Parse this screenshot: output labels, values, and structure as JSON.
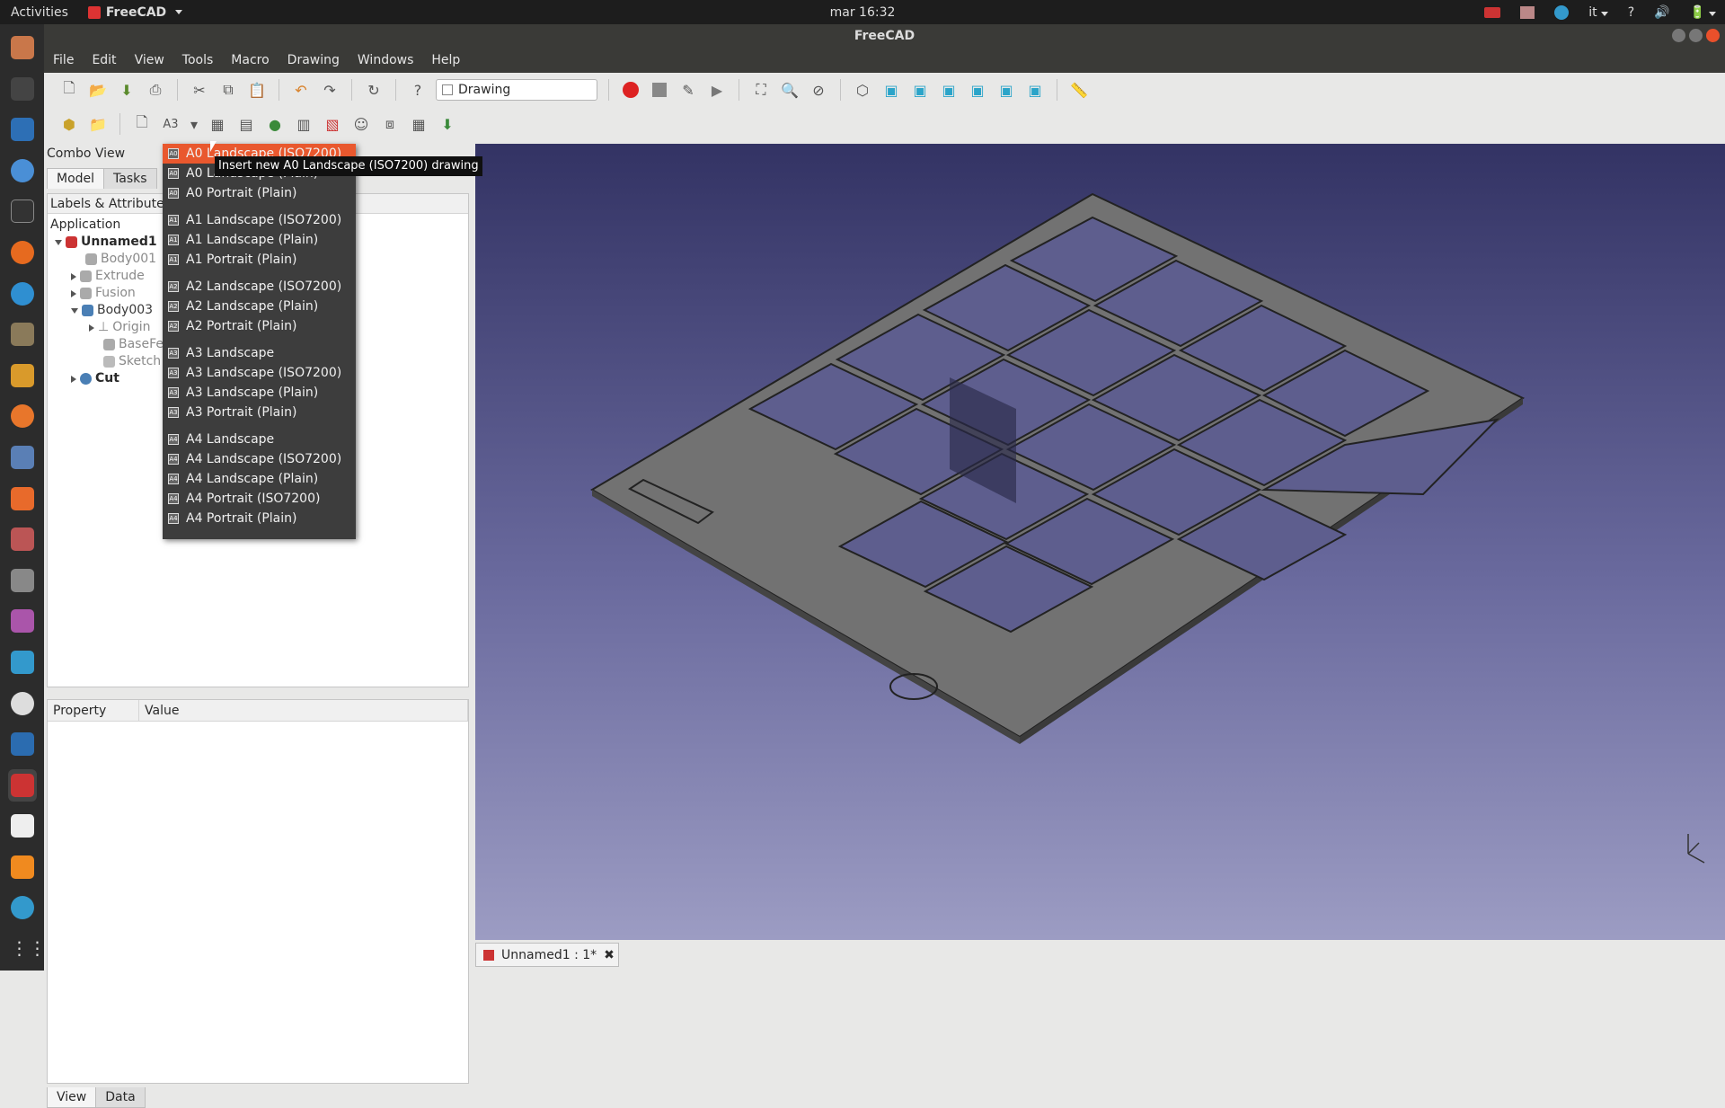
{
  "topbar": {
    "activities": "Activities",
    "app_name": "FreeCAD",
    "clock": "mar 16:32",
    "lang": "it",
    "help": "?"
  },
  "window": {
    "title": "FreeCAD"
  },
  "menu": [
    "File",
    "Edit",
    "View",
    "Tools",
    "Macro",
    "Drawing",
    "Windows",
    "Help"
  ],
  "toolbar": {
    "workbench": "Drawing"
  },
  "combo": {
    "title": "Combo View",
    "tabs": [
      "Model",
      "Tasks"
    ],
    "tree_header": "Labels & Attributes",
    "application": "Application",
    "tree": [
      {
        "label": "Unnamed1",
        "bold": true
      },
      {
        "label": "Body001"
      },
      {
        "label": "Extrude"
      },
      {
        "label": "Fusion"
      },
      {
        "label": "Body003"
      },
      {
        "label": "Origin"
      },
      {
        "label": "BaseFe"
      },
      {
        "label": "Sketch"
      },
      {
        "label": "Cut",
        "bold": true
      }
    ],
    "prop_headers": [
      "Property",
      "Value"
    ],
    "bottom_tabs": [
      "View",
      "Data"
    ]
  },
  "dropdown": {
    "items": [
      "A0 Landscape (ISO7200)",
      "A0 Landscape (Plain)",
      "A0 Portrait (Plain)",
      "A1 Landscape (ISO7200)",
      "A1 Landscape (Plain)",
      "A1 Portrait (Plain)",
      "A2 Landscape (ISO7200)",
      "A2 Landscape (Plain)",
      "A2 Portrait (Plain)",
      "A3 Landscape",
      "A3 Landscape (ISO7200)",
      "A3 Landscape (Plain)",
      "A3 Portrait (Plain)",
      "A4 Landscape",
      "A4 Landscape (ISO7200)",
      "A4 Landscape (Plain)",
      "A4 Portrait (ISO7200)",
      "A4 Portrait (Plain)"
    ],
    "tooltip": "Insert new A0 Landscape (ISO7200) drawing"
  },
  "doc_tab": "Unnamed1 : 1*",
  "colors": {
    "accent": "#e9582e",
    "dock": "#2c2c2c",
    "topbar": "#1d1d1d"
  }
}
